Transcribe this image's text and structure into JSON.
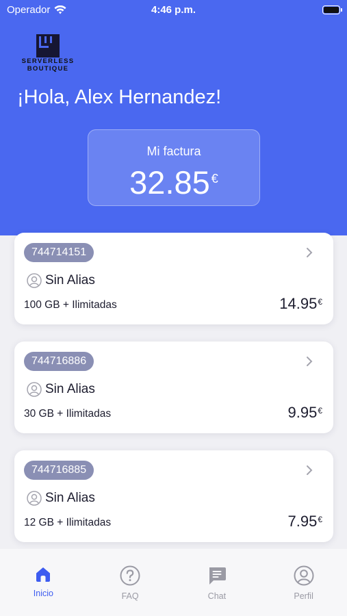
{
  "status_bar": {
    "carrier": "Operador",
    "time": "4:46 p.m."
  },
  "brand": {
    "line1": "SERVERLESS",
    "line2": "BOUTIQUE"
  },
  "greeting": "¡Hola, Alex Hernandez!",
  "invoice": {
    "label": "Mi factura",
    "amount": "32.85",
    "currency": "€"
  },
  "lines": [
    {
      "number": "744714151",
      "alias": "Sin Alias",
      "plan": "100 GB + Ilimitadas",
      "price": "14.95",
      "currency": "€"
    },
    {
      "number": "744716886",
      "alias": "Sin Alias",
      "plan": "30 GB + Ilimitadas",
      "price": "9.95",
      "currency": "€"
    },
    {
      "number": "744716885",
      "alias": "Sin Alias",
      "plan": "12 GB + Ilimitadas",
      "price": "7.95",
      "currency": "€"
    }
  ],
  "tabs": [
    {
      "label": "Inicio",
      "icon": "home-icon",
      "active": true
    },
    {
      "label": "FAQ",
      "icon": "question-icon",
      "active": false
    },
    {
      "label": "Chat",
      "icon": "chat-icon",
      "active": false
    },
    {
      "label": "Perfil",
      "icon": "profile-icon",
      "active": false
    }
  ],
  "colors": {
    "primary": "#4a68f0",
    "badge": "#8a8fb4",
    "tab_active": "#3d5cf0",
    "tab_inactive": "#9a9aa4"
  }
}
